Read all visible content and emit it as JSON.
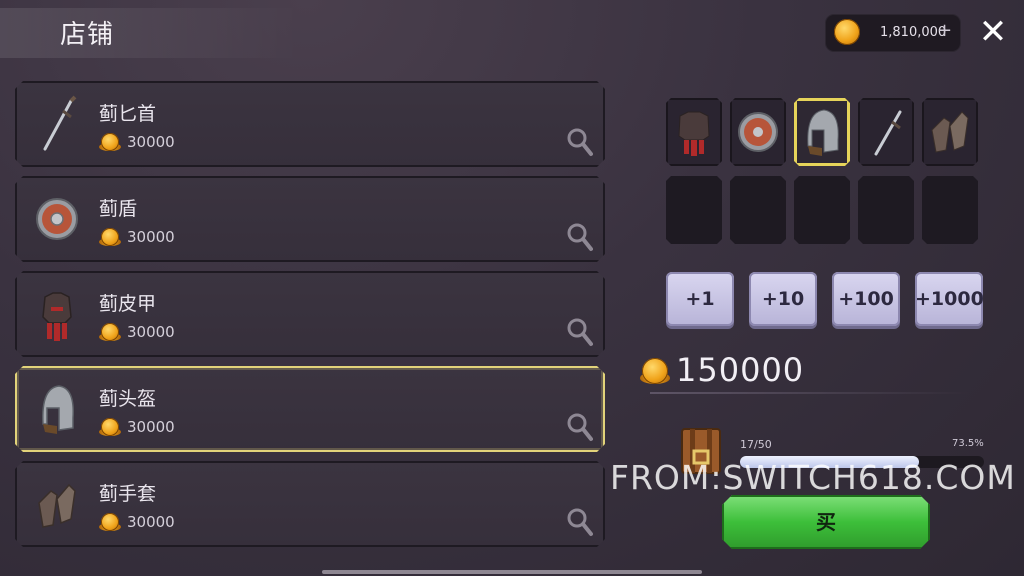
{
  "header": {
    "title": "店铺",
    "currency_amount": "1,810,000",
    "currency_plus": "+"
  },
  "icons": {
    "coin": "gold-coin-icon",
    "close": "close-icon",
    "search": "magnifier-icon"
  },
  "items": [
    {
      "name": "蓟匕首",
      "price": "30000",
      "icon": "dagger-icon"
    },
    {
      "name": "蓟盾",
      "price": "30000",
      "icon": "round-shield-icon"
    },
    {
      "name": "蓟皮甲",
      "price": "30000",
      "icon": "leather-armor-icon"
    },
    {
      "name": "蓟头盔",
      "price": "30000",
      "icon": "helmet-icon",
      "selected": true
    },
    {
      "name": "蓟手套",
      "price": "30000",
      "icon": "gauntlets-icon"
    }
  ],
  "cart_slots": [
    "leather-armor-icon",
    "round-shield-icon",
    "helmet-icon",
    "dagger-icon",
    "gauntlets-icon",
    "",
    "",
    "",
    "",
    ""
  ],
  "quantity_buttons": [
    "+1",
    "+10",
    "+100",
    "+1000"
  ],
  "total": "150000",
  "capacity": {
    "count": "17/50",
    "percent": "73.5%",
    "fill_fraction": 0.735
  },
  "watermark": "FROM:SWITCH618.COM",
  "buy_label": "买",
  "colors": {
    "selected_border": "#e2d37a",
    "buy_green": "#3dbf3a",
    "qty_button": "#c9c6e4"
  }
}
